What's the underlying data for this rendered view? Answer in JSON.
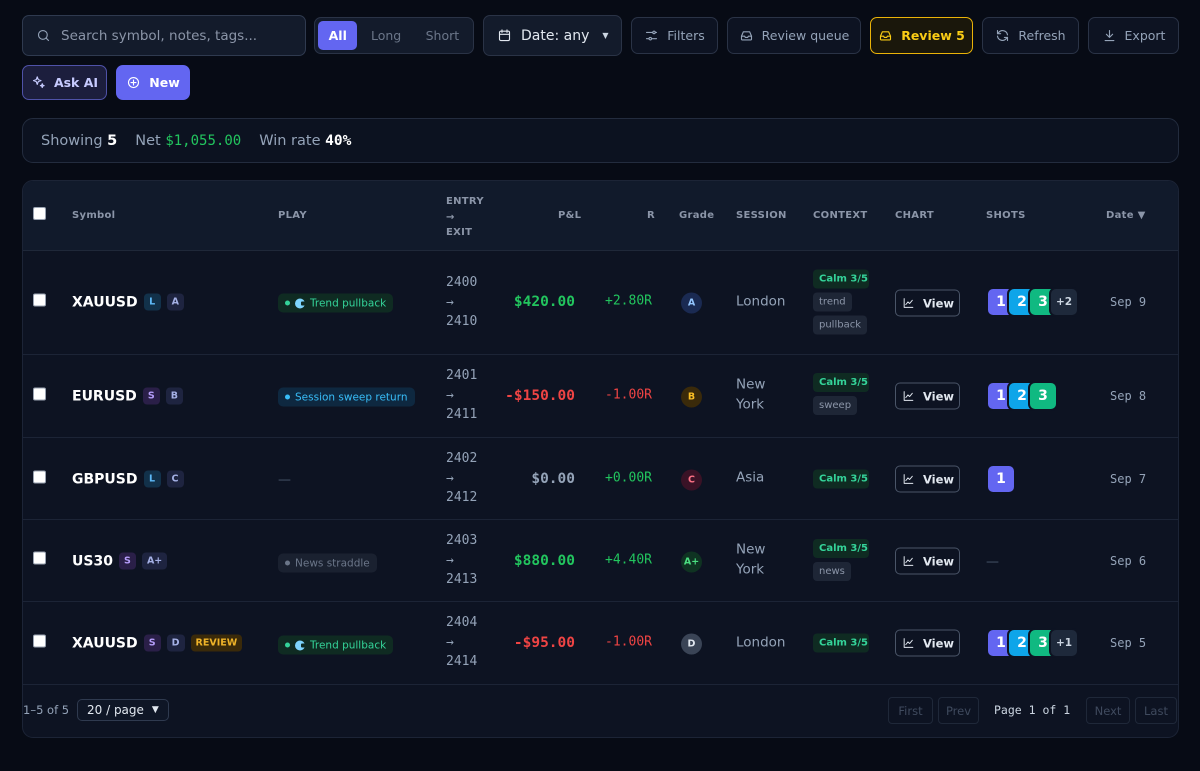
{
  "toolbar": {
    "search_placeholder": "Search symbol, notes, tags...",
    "direction_options": [
      "All",
      "Long",
      "Short"
    ],
    "date_label": "Date: any",
    "filters_label": "Filters",
    "review_queue_label": "Review queue",
    "review_label": "Review 5",
    "refresh_label": "Refresh",
    "export_label": "Export",
    "ask_ai_label": "Ask AI",
    "new_label": "New"
  },
  "summary": {
    "showing_label": "Showing",
    "showing_count": "5",
    "net_label": "Net",
    "net_value": "$1,055.00",
    "winrate_label": "Win rate",
    "winrate_value": "40%"
  },
  "columns": {
    "symbol": "Symbol",
    "play": "PLAY",
    "entry": "ENTRY",
    "arrow": "→",
    "exit": "EXIT",
    "pnl": "P&L",
    "r": "R",
    "grade": "Grade",
    "session": "SESSION",
    "context": "CONTEXT",
    "chart": "CHART",
    "shots": "SHOTS",
    "date": "Date ▼"
  },
  "rows": [
    {
      "symbol": "XAUUSD",
      "side": "L",
      "grade_badge": "A",
      "review": "",
      "play": "Trend pullback",
      "entry": "2400",
      "arrow": "→",
      "exit": "2410",
      "pnl": "$420.00",
      "r": "+2.80R",
      "grade": "A",
      "session": "London",
      "calm": "Calm 3/5",
      "tags": [
        "trend",
        "pullback"
      ],
      "view": "View",
      "shots": [
        "1",
        "2",
        "3"
      ],
      "more": "+2",
      "date": "Sep 9"
    },
    {
      "symbol": "EURUSD",
      "side": "S",
      "grade_badge": "B",
      "review": "",
      "play": "Session sweep return",
      "entry": "2401",
      "arrow": "→",
      "exit": "2411",
      "pnl": "-$150.00",
      "r": "-1.00R",
      "grade": "B",
      "session": "New York",
      "calm": "Calm 3/5",
      "tags": [
        "sweep"
      ],
      "view": "View",
      "shots": [
        "1",
        "2",
        "3"
      ],
      "more": "",
      "date": "Sep 8"
    },
    {
      "symbol": "GBPUSD",
      "side": "L",
      "grade_badge": "C",
      "review": "",
      "play": "—",
      "entry": "2402",
      "arrow": "→",
      "exit": "2412",
      "pnl": "$0.00",
      "r": "+0.00R",
      "grade": "C",
      "session": "Asia",
      "calm": "Calm 3/5",
      "tags": [],
      "view": "View",
      "shots": [
        "1"
      ],
      "more": "",
      "date": "Sep 7"
    },
    {
      "symbol": "US30",
      "side": "S",
      "grade_badge": "A+",
      "review": "",
      "play": "News straddle",
      "entry": "2403",
      "arrow": "→",
      "exit": "2413",
      "pnl": "$880.00",
      "r": "+4.40R",
      "grade": "A+",
      "session": "New York",
      "calm": "Calm 3/5",
      "tags": [
        "news"
      ],
      "view": "View",
      "shots": [],
      "shots_empty": "—",
      "more": "",
      "date": "Sep 6"
    },
    {
      "symbol": "XAUUSD",
      "side": "S",
      "grade_badge": "D",
      "review": "REVIEW",
      "play": "Trend pullback",
      "entry": "2404",
      "arrow": "→",
      "exit": "2414",
      "pnl": "-$95.00",
      "r": "-1.00R",
      "grade": "D",
      "session": "London",
      "calm": "Calm 3/5",
      "tags": [],
      "view": "View",
      "shots": [
        "1",
        "2",
        "3"
      ],
      "more": "+1",
      "date": "Sep 5"
    }
  ],
  "pagination": {
    "range": "1–5 of 5",
    "page_size": "20 / page",
    "first": "First",
    "prev": "Prev",
    "page_label": "Page 1 of 1",
    "next": "Next",
    "last": "Last"
  }
}
